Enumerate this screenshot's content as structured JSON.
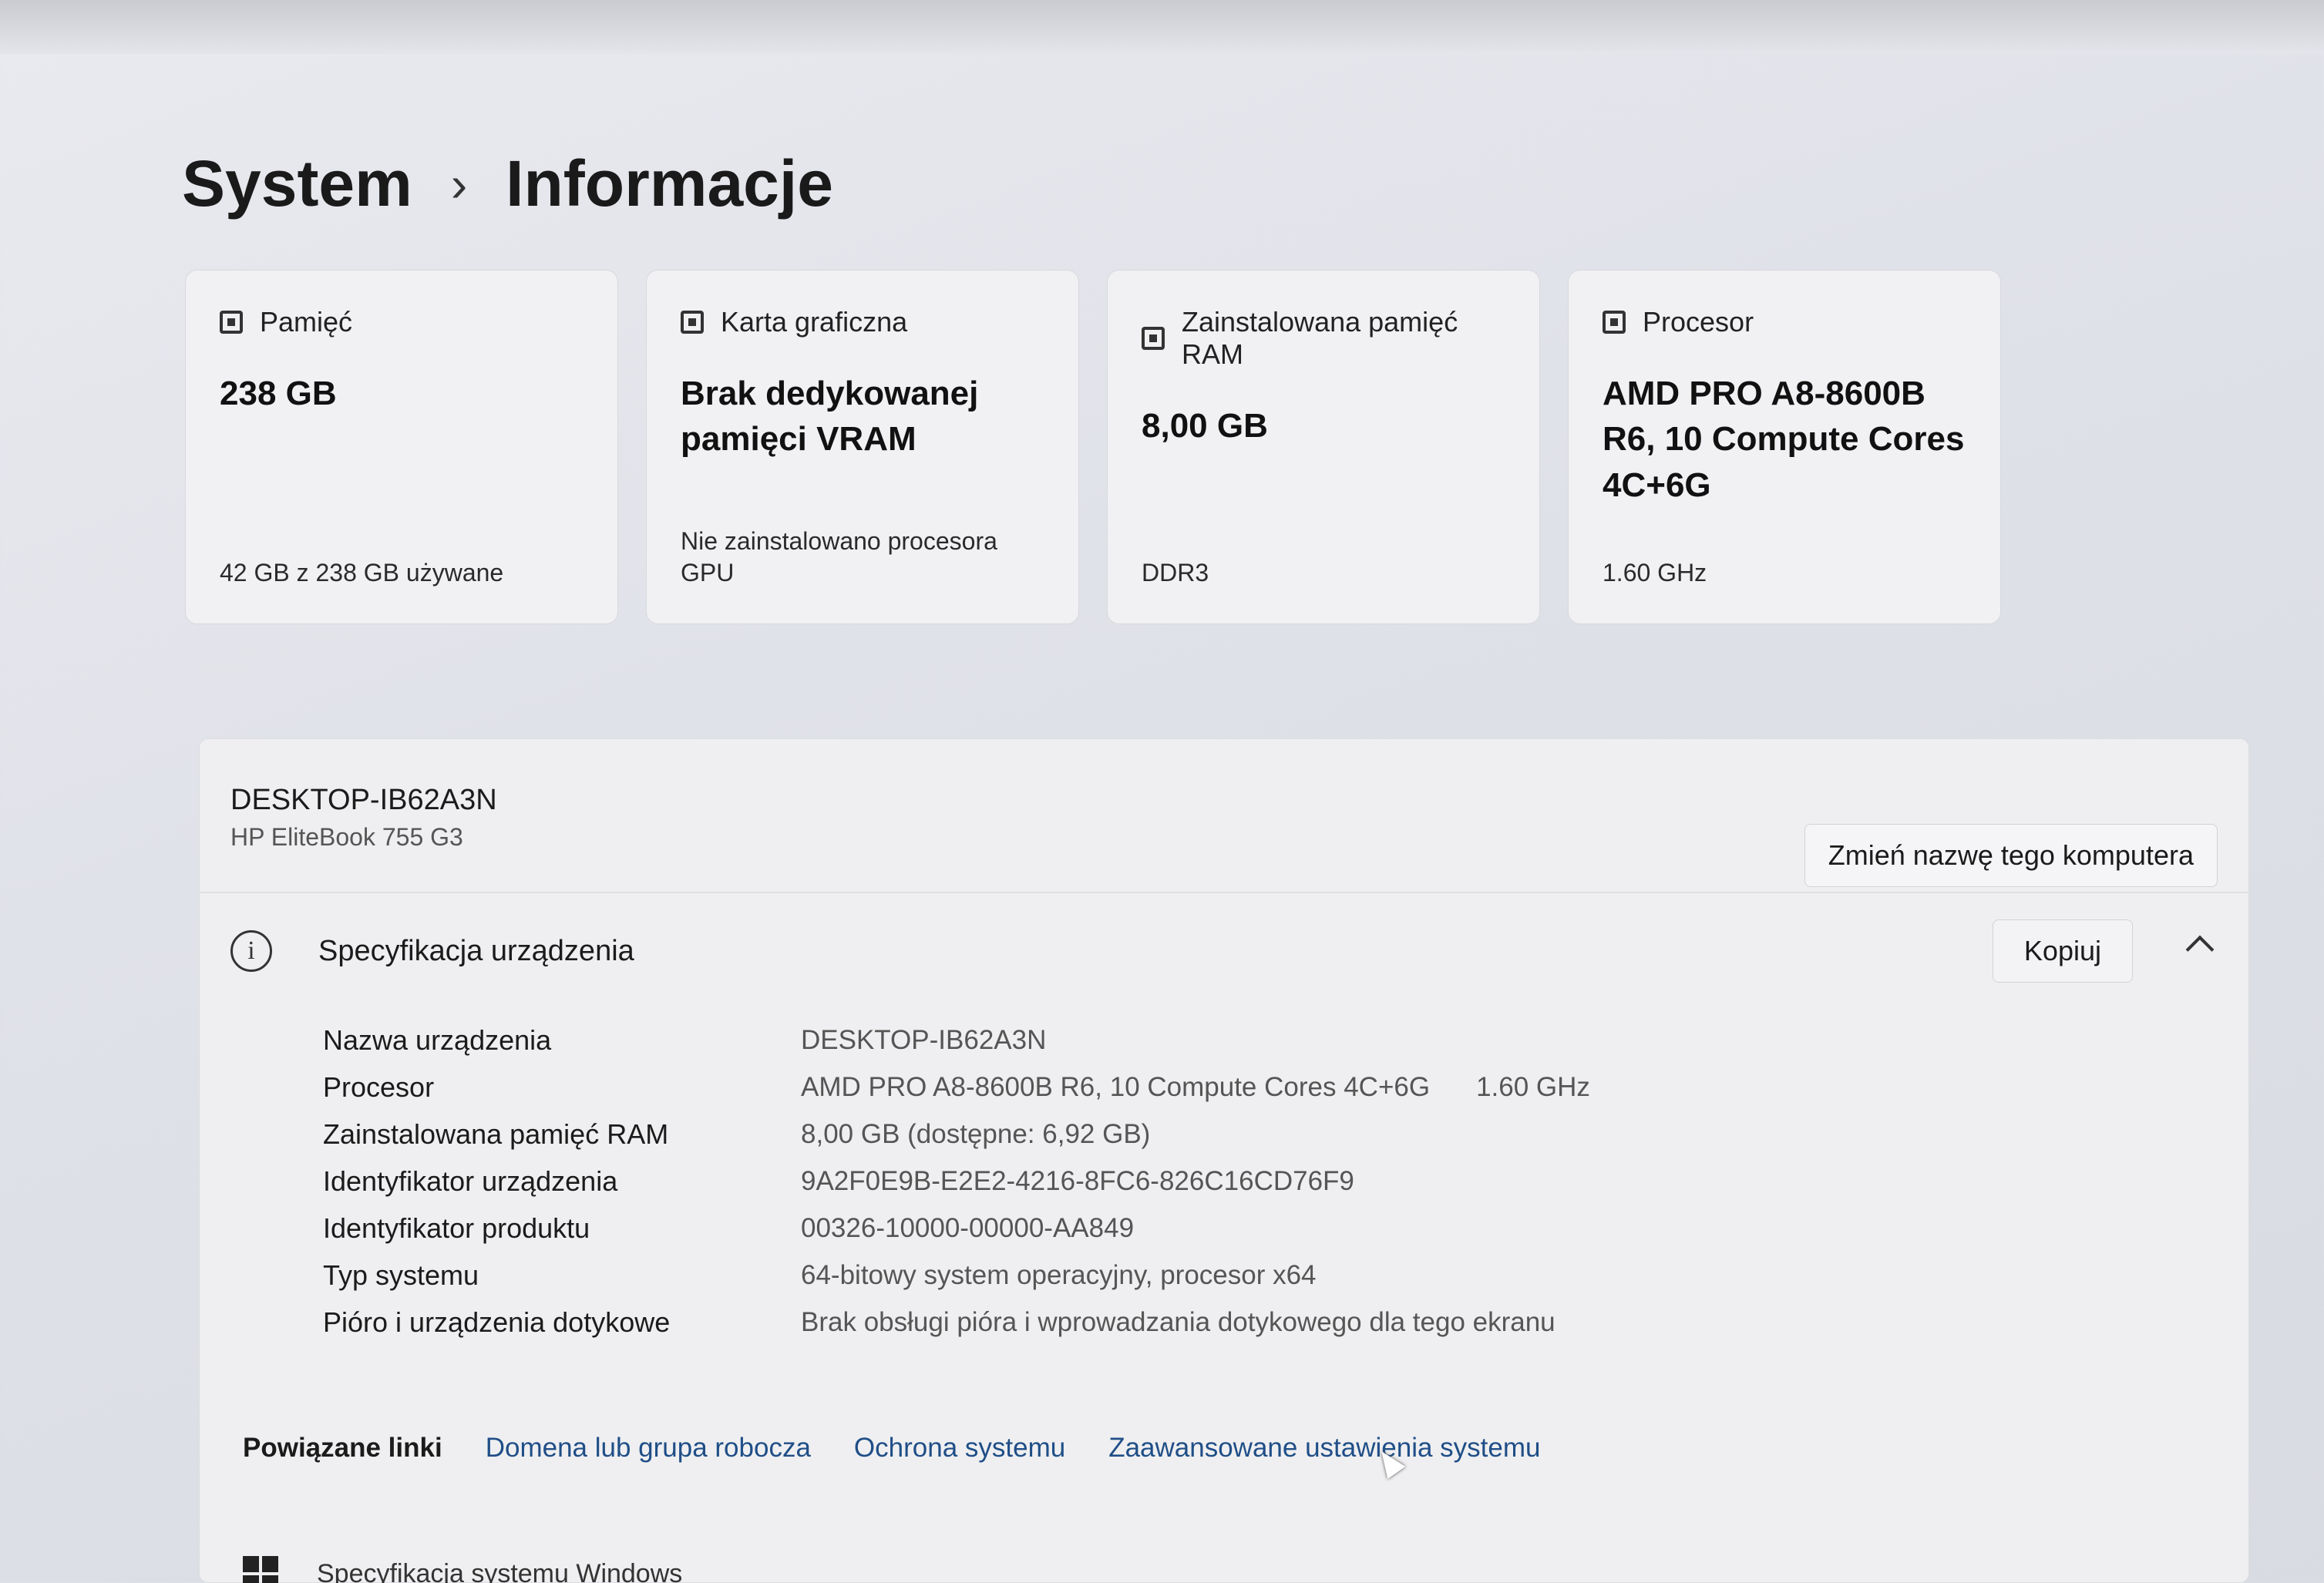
{
  "breadcrumb": {
    "parent": "System",
    "separator": "›",
    "current": "Informacje"
  },
  "cards": [
    {
      "title": "Pamięć",
      "value": "238 GB",
      "sub": "42 GB z 238 GB używane"
    },
    {
      "title": "Karta graficzna",
      "value": "Brak dedykowanej pamięci VRAM",
      "sub": "Nie zainstalowano procesora GPU"
    },
    {
      "title": "Zainstalowana pamięć RAM",
      "value": "8,00 GB",
      "sub": "DDR3"
    },
    {
      "title": "Procesor",
      "value": "AMD PRO A8-8600B R6, 10 Compute Cores 4C+6G",
      "sub": "1.60 GHz"
    }
  ],
  "device": {
    "name": "DESKTOP-IB62A3N",
    "model": "HP EliteBook 755 G3",
    "rename_label": "Zmień nazwę tego komputera"
  },
  "spec": {
    "title": "Specyfikacja urządzenia",
    "copy_label": "Kopiuj",
    "rows": [
      {
        "label": "Nazwa urządzenia",
        "value": "DESKTOP-IB62A3N",
        "extra": ""
      },
      {
        "label": "Procesor",
        "value": "AMD PRO A8-8600B R6, 10 Compute Cores 4C+6G",
        "extra": "1.60 GHz"
      },
      {
        "label": "Zainstalowana pamięć RAM",
        "value": "8,00 GB (dostępne: 6,92 GB)",
        "extra": ""
      },
      {
        "label": "Identyfikator urządzenia",
        "value": "9A2F0E9B-E2E2-4216-8FC6-826C16CD76F9",
        "extra": ""
      },
      {
        "label": "Identyfikator produktu",
        "value": "00326-10000-00000-AA849",
        "extra": ""
      },
      {
        "label": "Typ systemu",
        "value": "64-bitowy system operacyjny, procesor x64",
        "extra": ""
      },
      {
        "label": "Pióro i urządzenia dotykowe",
        "value": "Brak obsługi pióra i wprowadzania dotykowego dla tego ekranu",
        "extra": ""
      }
    ]
  },
  "related_links": {
    "label": "Powiązane linki",
    "items": [
      "Domena lub grupa robocza",
      "Ochrona systemu",
      "Zaawansowane ustawienia systemu"
    ]
  },
  "bottom": {
    "label": "Specyfikacja systemu Windows"
  }
}
